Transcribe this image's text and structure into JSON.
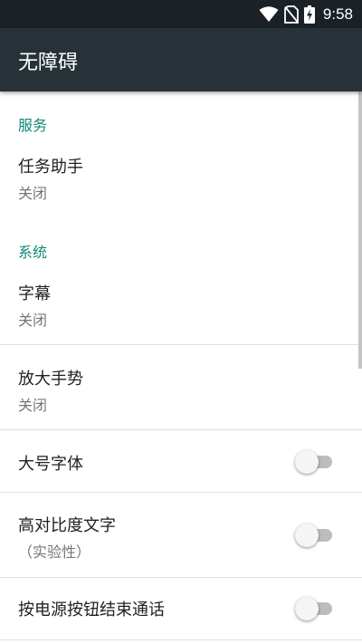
{
  "status_bar": {
    "time": "9:58",
    "icons": [
      "wifi-icon",
      "no-sim-icon",
      "battery-charging-icon"
    ]
  },
  "app_bar": {
    "title": "无障碍"
  },
  "sections": [
    {
      "header": "服务",
      "items": [
        {
          "title": "任务助手",
          "summary": "关闭"
        }
      ]
    },
    {
      "header": "系统",
      "items": [
        {
          "title": "字幕",
          "summary": "关闭"
        },
        {
          "title": "放大手势",
          "summary": "关闭"
        },
        {
          "title": "大号字体",
          "switch": "off"
        },
        {
          "title": "高对比度文字",
          "summary": "（实验性）",
          "switch": "off"
        },
        {
          "title": "按电源按钮结束通话",
          "switch": "off"
        }
      ]
    }
  ],
  "colors": {
    "status_bar": "#1b2227",
    "app_bar": "#263238",
    "accent": "#11897a",
    "switch_track_off": "#bdbdbd"
  }
}
